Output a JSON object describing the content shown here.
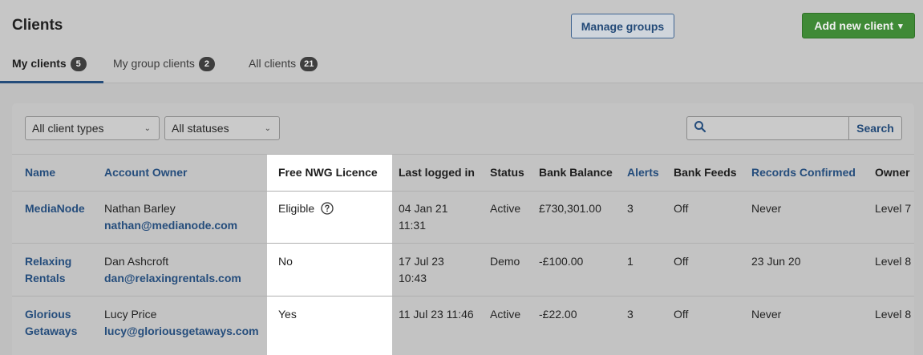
{
  "header": {
    "title": "Clients",
    "manage_groups": "Manage groups",
    "add_new_client": "Add new client"
  },
  "tabs": [
    {
      "label": "My clients",
      "count": "5",
      "active": true
    },
    {
      "label": "My group clients",
      "count": "2",
      "active": false
    },
    {
      "label": "All clients",
      "count": "21",
      "active": false
    }
  ],
  "filters": {
    "client_types": "All client types",
    "statuses": "All statuses",
    "search_placeholder": "",
    "search_button": "Search"
  },
  "table": {
    "columns": [
      "Name",
      "Account Owner",
      "Free NWG Licence",
      "Last logged in",
      "Status",
      "Bank Balance",
      "Alerts",
      "Bank Feeds",
      "Records Confirmed",
      "Owner"
    ],
    "rows": [
      {
        "name": [
          "MediaNode",
          ""
        ],
        "owner_name": "Nathan Barley",
        "owner_email": "nathan@medianode.com",
        "licence": "Eligible",
        "last_logged": [
          "04 Jan 21",
          "11:31"
        ],
        "status": "Active",
        "balance": "£730,301.00",
        "alerts": "3",
        "bank_feeds": "Off",
        "records_confirmed": "Never",
        "owner": "Level 7"
      },
      {
        "name": [
          "Relaxing",
          "Rentals"
        ],
        "owner_name": "Dan Ashcroft",
        "owner_email": "dan@relaxingrentals.com",
        "licence": "No",
        "last_logged": [
          "17 Jul 23",
          "10:43"
        ],
        "status": "Demo",
        "balance": "-£100.00",
        "alerts": "1",
        "bank_feeds": "Off",
        "records_confirmed": "23 Jun 20",
        "owner": "Level 8"
      },
      {
        "name": [
          "Glorious",
          "Getaways"
        ],
        "owner_name": "Lucy Price",
        "owner_email": "lucy@gloriousgetaways.com",
        "licence": "Yes",
        "last_logged": [
          "11 Jul 23 11:46",
          ""
        ],
        "status": "Active",
        "balance": "-£22.00",
        "alerts": "3",
        "bank_feeds": "Off",
        "records_confirmed": "Never",
        "owner": "Level 8"
      }
    ]
  },
  "colors": {
    "brand_blue": "#254d7c",
    "add_button_green": "#3f8a36",
    "badge": "#3e3e3e"
  }
}
